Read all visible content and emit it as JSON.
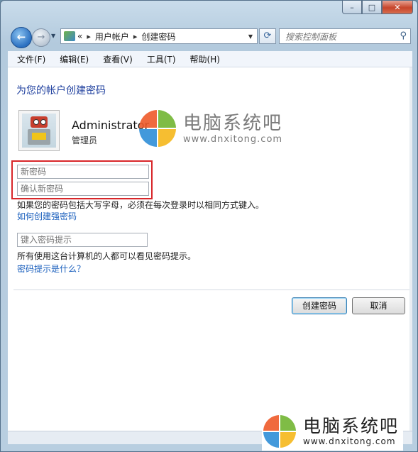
{
  "window": {
    "caption_buttons": {
      "minimize": "–",
      "maximize": "□",
      "close": "✕"
    }
  },
  "nav": {
    "back_glyph": "←",
    "forward_glyph": "→",
    "breadcrumb": [
      "用户帐户",
      "创建密码"
    ],
    "breadcrumb_prefix": "«",
    "breadcrumb_separator": "▸",
    "search_placeholder": "搜索控制面板"
  },
  "menu": [
    "文件(F)",
    "编辑(E)",
    "查看(V)",
    "工具(T)",
    "帮助(H)"
  ],
  "page": {
    "title": "为您的帐户创建密码",
    "user": {
      "name": "Administrator",
      "role": "管理员"
    },
    "new_password_placeholder": "新密码",
    "confirm_password_placeholder": "确认新密码",
    "case_note": "如果您的密码包括大写字母，必须在每次登录时以相同方式键入。",
    "strong_password_link": "如何创建强密码",
    "hint_placeholder": "键入密码提示",
    "hint_note": "所有使用这台计算机的人都可以看见密码提示。",
    "hint_link": "密码提示是什么？",
    "create_button": "创建密码",
    "cancel_button": "取消"
  },
  "watermark": {
    "brand": "电脑系统吧",
    "url": "www.dnxitong.com"
  },
  "colors": {
    "title": "#1e3f9e",
    "link": "#1a5fbd",
    "highlight_box": "#d8262a"
  }
}
